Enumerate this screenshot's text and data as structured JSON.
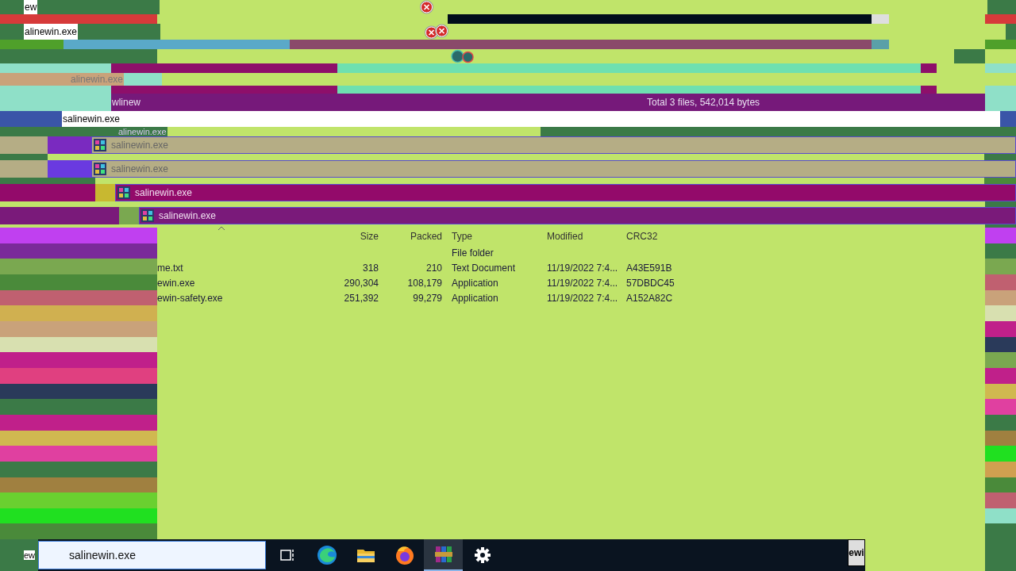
{
  "fragments": [
    {
      "text": "ew"
    },
    {
      "text": "alinewin.exe"
    },
    {
      "text": "alinewin.exe"
    },
    {
      "text": "wlinew"
    },
    {
      "text": "salinewin.exe"
    },
    {
      "text": "alinewin.exe"
    }
  ],
  "status_bar": {
    "text": "Total 3 files, 542,014 bytes"
  },
  "ghost_rows": [
    {
      "name": "salinewin.exe"
    },
    {
      "name": "salinewin.exe"
    },
    {
      "name": "salinewin.exe"
    },
    {
      "name": "salinewin.exe"
    }
  ],
  "table": {
    "columns": [
      "Size",
      "Packed",
      "Type",
      "Modified",
      "CRC32"
    ],
    "rows": [
      {
        "type": "File folder"
      },
      {
        "name": "me.txt",
        "size": "318",
        "packed": "210",
        "type": "Text Document",
        "modified": "11/19/2022 7:4...",
        "crc32": "A43E591B"
      },
      {
        "name": "ewin.exe",
        "size": "290,304",
        "packed": "108,179",
        "type": "Application",
        "modified": "11/19/2022 7:4...",
        "crc32": "57DBDC45"
      },
      {
        "name": "ewin-safety.exe",
        "size": "251,392",
        "packed": "99,279",
        "type": "Application",
        "modified": "11/19/2022 7:4...",
        "crc32": "A152A82C"
      }
    ]
  },
  "taskbar": {
    "corner_fragment": "ew",
    "search": {
      "value": "salinewin.exe"
    },
    "apps": [
      {
        "kind": "taskview",
        "selected": false
      },
      {
        "kind": "edge",
        "selected": false
      },
      {
        "kind": "folder",
        "selected": false
      },
      {
        "kind": "firefox",
        "selected": false
      },
      {
        "kind": "archive",
        "selected": true
      },
      {
        "kind": "gear",
        "selected": false
      }
    ],
    "button_fragment": "ewi"
  }
}
